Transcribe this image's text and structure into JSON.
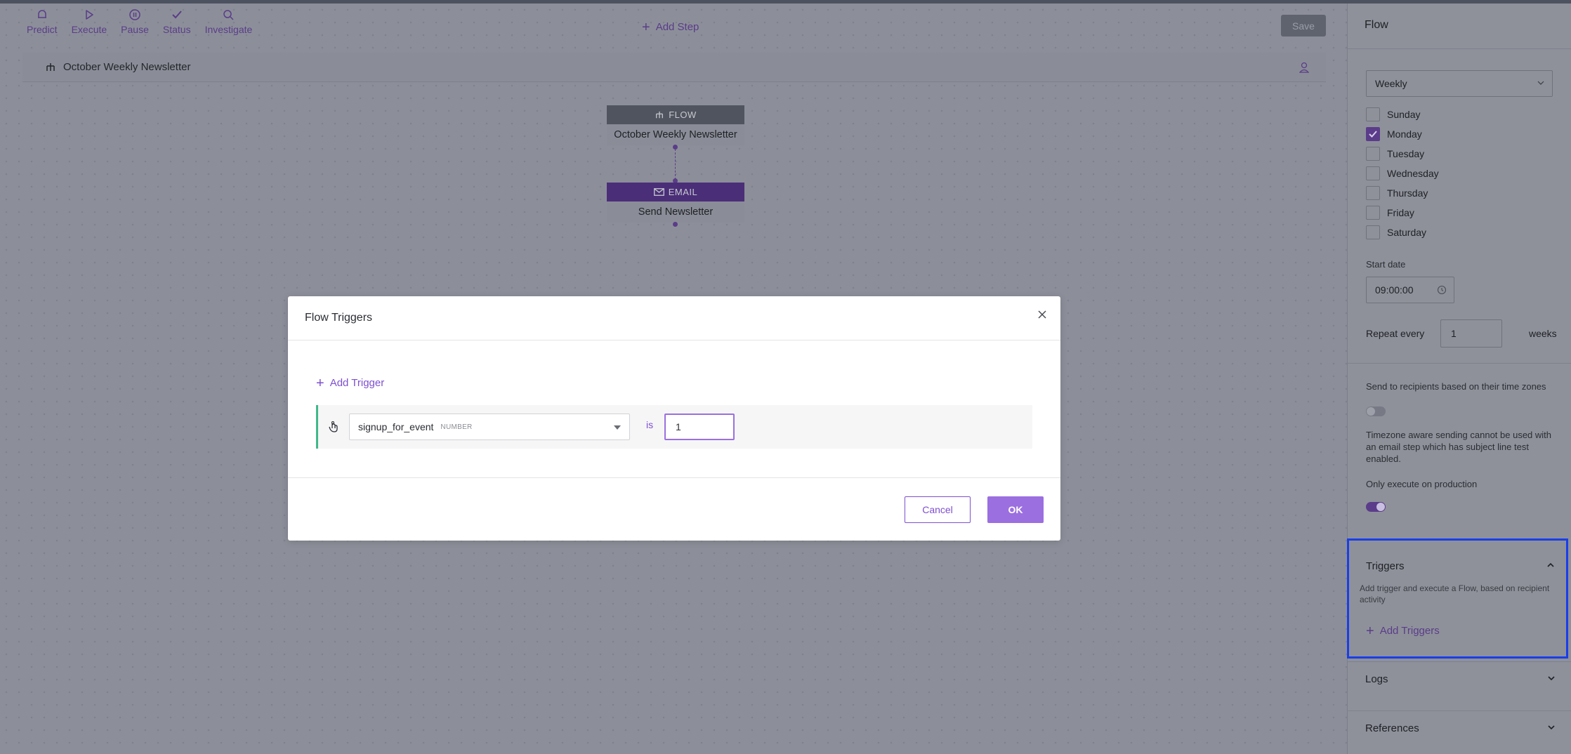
{
  "toolbar": {
    "items": [
      {
        "label": "Predict",
        "icon": "predict-icon"
      },
      {
        "label": "Execute",
        "icon": "play-icon"
      },
      {
        "label": "Pause",
        "icon": "pause-icon"
      },
      {
        "label": "Status",
        "icon": "check-icon"
      },
      {
        "label": "Investigate",
        "icon": "search-icon"
      }
    ],
    "add_step": "Add Step",
    "save": "Save"
  },
  "flow_bar": {
    "name": "October Weekly Newsletter"
  },
  "canvas": {
    "flow_node": {
      "type": "FLOW",
      "name": "October Weekly Newsletter"
    },
    "email_node": {
      "type": "EMAIL",
      "name": "Send Newsletter"
    }
  },
  "sidebar": {
    "title": "Flow",
    "frequency": "Weekly",
    "days": [
      {
        "label": "Sunday",
        "checked": false
      },
      {
        "label": "Monday",
        "checked": true
      },
      {
        "label": "Tuesday",
        "checked": false
      },
      {
        "label": "Wednesday",
        "checked": false
      },
      {
        "label": "Thursday",
        "checked": false
      },
      {
        "label": "Friday",
        "checked": false
      },
      {
        "label": "Saturday",
        "checked": false
      }
    ],
    "start_date_label": "Start date",
    "start_time": "09:00:00",
    "repeat_label": "Repeat every",
    "repeat_value": "1",
    "repeat_unit": "weeks",
    "timezone_label": "Send to recipients based on their time zones",
    "timezone_enabled": false,
    "timezone_note": "Timezone aware sending cannot be used with an email step which has subject line test enabled.",
    "production_label": "Only execute on production",
    "production_enabled": true,
    "triggers": {
      "title": "Triggers",
      "description": "Add trigger and execute a Flow, based on recipient activity",
      "add_label": "Add Triggers"
    },
    "logs": "Logs",
    "references": "References"
  },
  "modal": {
    "title": "Flow Triggers",
    "add_trigger": "Add Trigger",
    "trigger": {
      "field": "signup_for_event",
      "field_type": "NUMBER",
      "operator": "is",
      "value": "1"
    },
    "cancel": "Cancel",
    "ok": "OK"
  },
  "colors": {
    "accent": "#7d4fd0",
    "trigger_border": "#3fb98a",
    "highlight_box": "#1a3de8"
  }
}
